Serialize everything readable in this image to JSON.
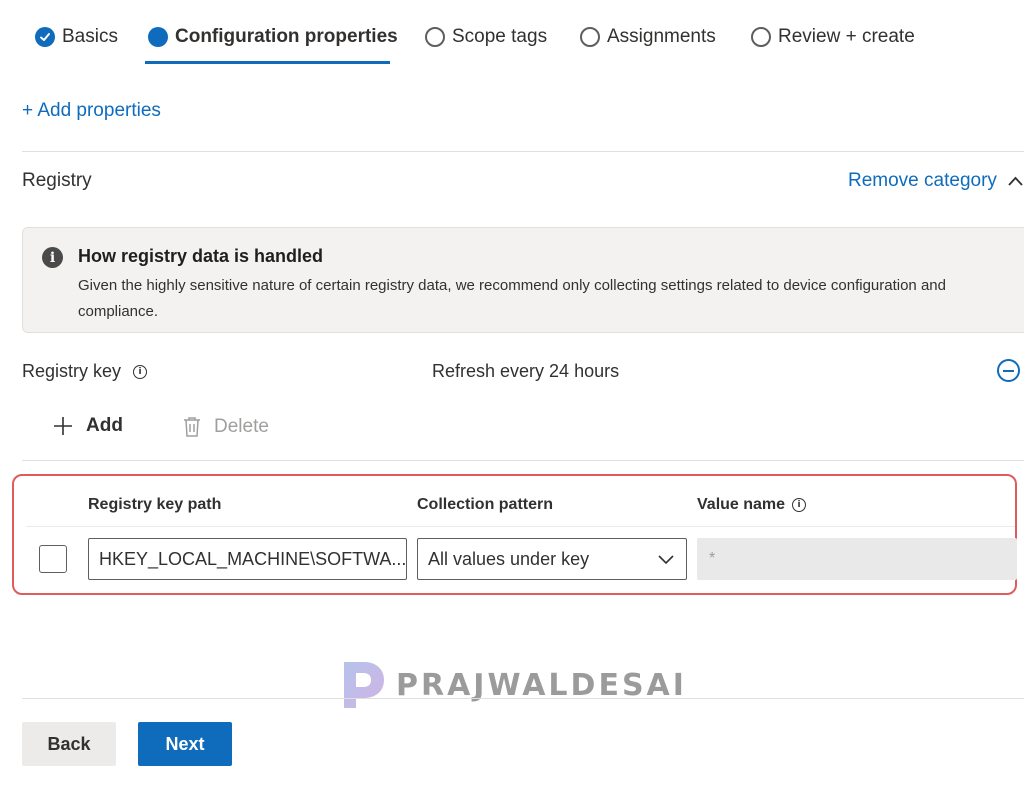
{
  "wizard": {
    "steps": [
      {
        "label": "Basics",
        "state": "completed"
      },
      {
        "label": "Configuration properties",
        "state": "current"
      },
      {
        "label": "Scope tags",
        "state": "pending"
      },
      {
        "label": "Assignments",
        "state": "pending"
      },
      {
        "label": "Review + create",
        "state": "pending"
      }
    ]
  },
  "add_properties_link": "+ Add properties",
  "category": {
    "title": "Registry",
    "remove_label": "Remove category"
  },
  "info_banner": {
    "title": "How registry data is handled",
    "text": "Given the highly sensitive nature of certain registry data, we recommend only collecting settings related to device configuration and compliance."
  },
  "registry_key": {
    "label": "Registry key",
    "refresh_text": "Refresh every 24 hours"
  },
  "commands": {
    "add_label": "Add",
    "delete_label": "Delete"
  },
  "grid": {
    "columns": [
      "Registry key path",
      "Collection pattern",
      "Value name"
    ],
    "rows": [
      {
        "path": "HKEY_LOCAL_MACHINE\\SOFTWA...",
        "pattern": "All values under key",
        "value_placeholder": "*"
      }
    ]
  },
  "watermark": {
    "text": "PRAJWALDESAI"
  },
  "footer": {
    "back_label": "Back",
    "next_label": "Next"
  },
  "colors": {
    "accent": "#0f6cbd",
    "highlight_border": "#e05c5c"
  }
}
